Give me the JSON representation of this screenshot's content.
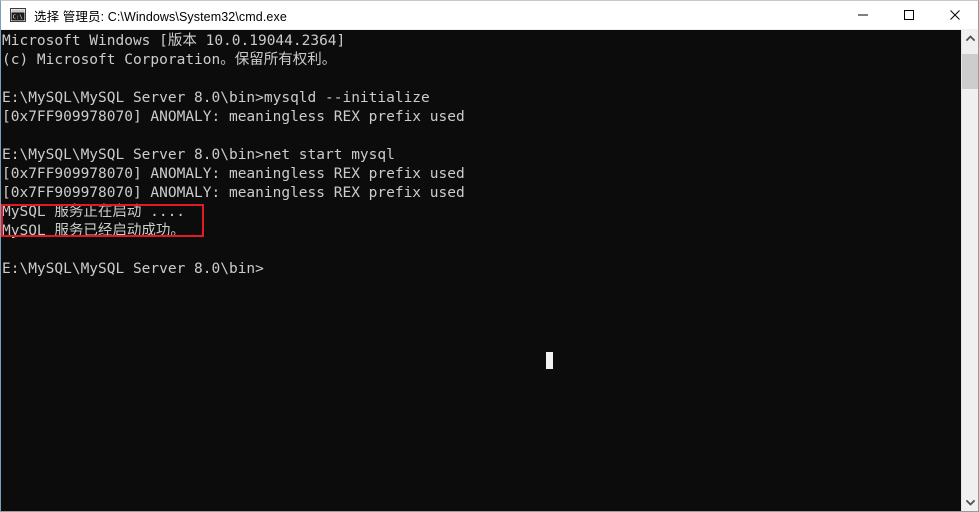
{
  "window": {
    "title": "选择 管理员: C:\\Windows\\System32\\cmd.exe",
    "icon": "cmd-console-icon",
    "background": "#0c0c0c",
    "foreground": "#cccccc",
    "controls": {
      "minimize": "minimize-icon",
      "maximize": "maximize-icon",
      "close": "close-icon"
    }
  },
  "console": {
    "lines": [
      "Microsoft Windows [版本 10.0.19044.2364]",
      "(c) Microsoft Corporation。保留所有权利。",
      "",
      "E:\\MySQL\\MySQL Server 8.0\\bin>mysqld --initialize",
      "[0x7FF909978070] ANOMALY: meaningless REX prefix used",
      "",
      "E:\\MySQL\\MySQL Server 8.0\\bin>net start mysql",
      "[0x7FF909978070] ANOMALY: meaningless REX prefix used",
      "[0x7FF909978070] ANOMALY: meaningless REX prefix used",
      "MySQL 服务正在启动 ....",
      "MySQL 服务已经启动成功。",
      "",
      "E:\\MySQL\\MySQL Server 8.0\\bin>"
    ],
    "prompt": "E:\\MySQL\\MySQL Server 8.0\\bin>",
    "commands": [
      "mysqld --initialize",
      "net start mysql"
    ],
    "cursor": "text-cursor-block"
  },
  "annotation": {
    "type": "red-rectangle",
    "color": "#e01b24",
    "highlights": [
      "MySQL 服务正在启动 ....",
      "MySQL 服务已经启动成功。"
    ]
  },
  "scrollbar": {
    "up_arrow": "chevron-up-icon",
    "down_arrow": "chevron-down-icon",
    "thumb": "scrollbar-thumb",
    "thumb_color": "#cdcdcd"
  }
}
